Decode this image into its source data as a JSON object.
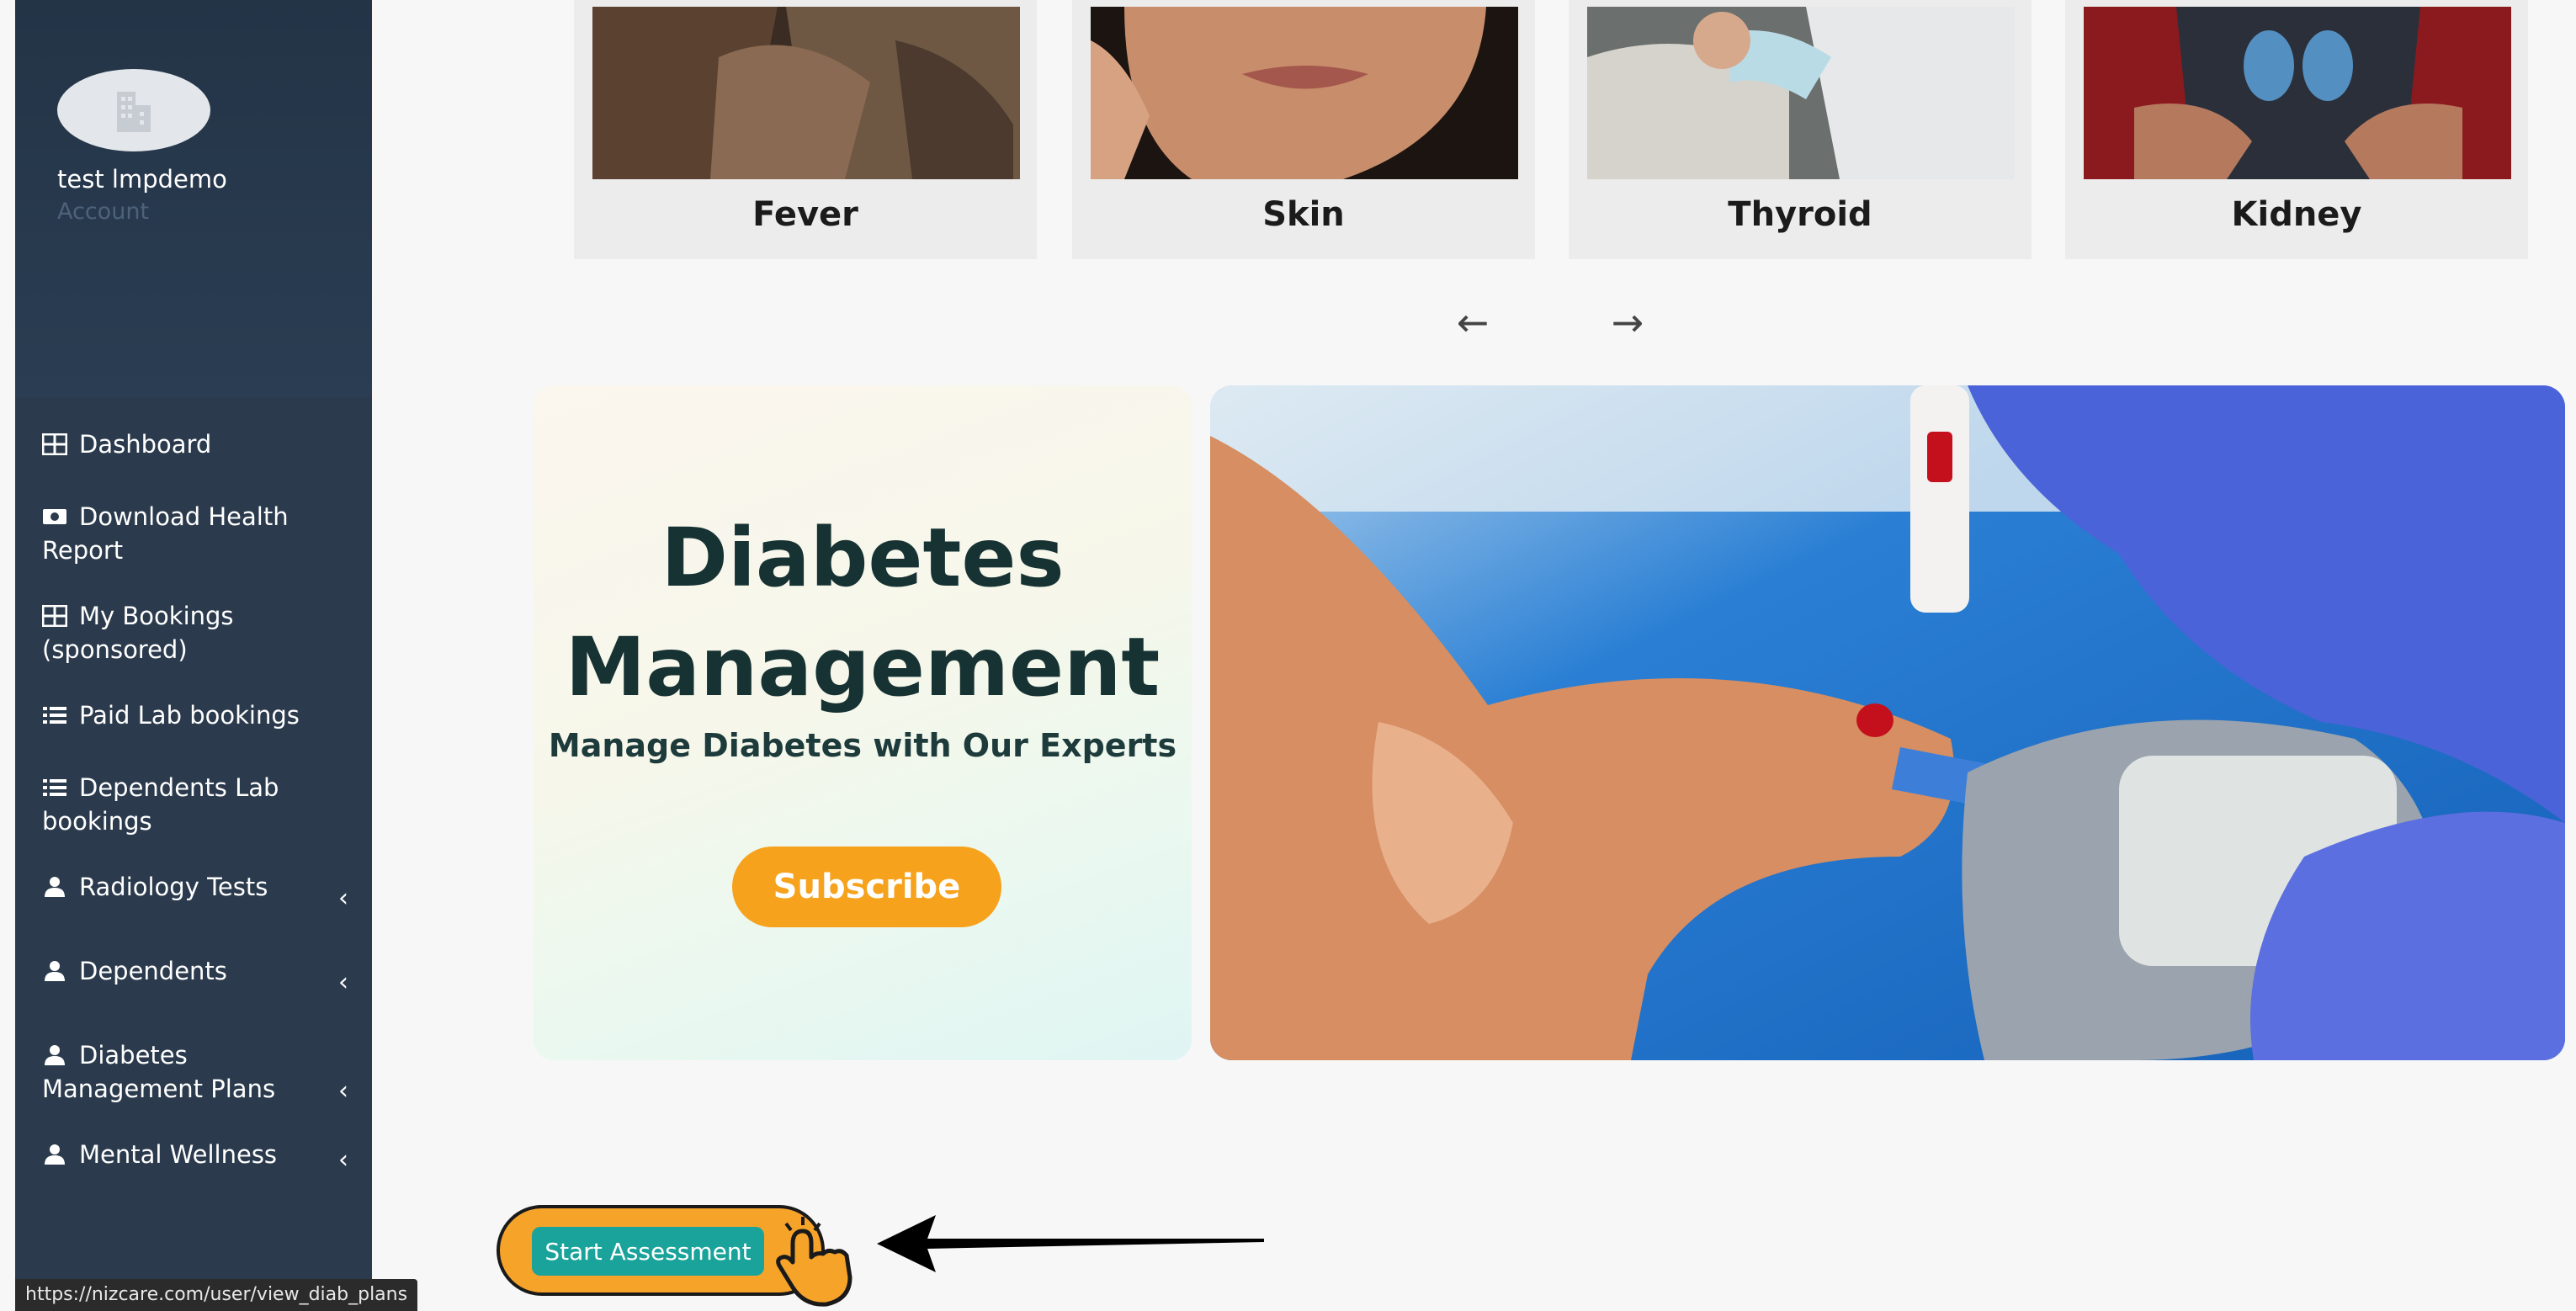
{
  "profile": {
    "name": "test lmpdemo",
    "role": "Account"
  },
  "nav": [
    {
      "label": "Dashboard",
      "icon": "grid-icon"
    },
    {
      "label": "Download Health Report",
      "icon": "download-icon"
    },
    {
      "label": "My Bookings (sponsored)",
      "icon": "grid-icon"
    },
    {
      "label": "Paid Lab bookings",
      "icon": "list-icon"
    },
    {
      "label": "Dependents Lab bookings",
      "icon": "list-icon"
    },
    {
      "label": "Radiology Tests",
      "icon": "user-icon",
      "chevron": "‹"
    },
    {
      "label": "Dependents",
      "icon": "user-icon",
      "chevron": "‹"
    },
    {
      "label": "Diabetes Management Plans",
      "icon": "user-icon",
      "chevron": "‹"
    },
    {
      "label": "Mental Wellness",
      "icon": "user-icon",
      "chevron": "‹"
    }
  ],
  "status_url": "https://nizcare.com/user/view_diab_plans",
  "categories": [
    {
      "label": "Fever"
    },
    {
      "label": "Skin"
    },
    {
      "label": "Thyroid"
    },
    {
      "label": "Kidney"
    }
  ],
  "carousel": {
    "prev": "←",
    "next": "→"
  },
  "promo": {
    "title_line1": "Diabetes",
    "title_line2": "Management",
    "subtitle": "Manage Diabetes with Our Experts",
    "button": "Subscribe"
  },
  "cta": {
    "label": "Start Assessment"
  },
  "colors": {
    "sidebar": "#2b3b4d",
    "accent_orange": "#f6a21c",
    "teal_button": "#1aa39a",
    "title_dark": "#173233"
  }
}
